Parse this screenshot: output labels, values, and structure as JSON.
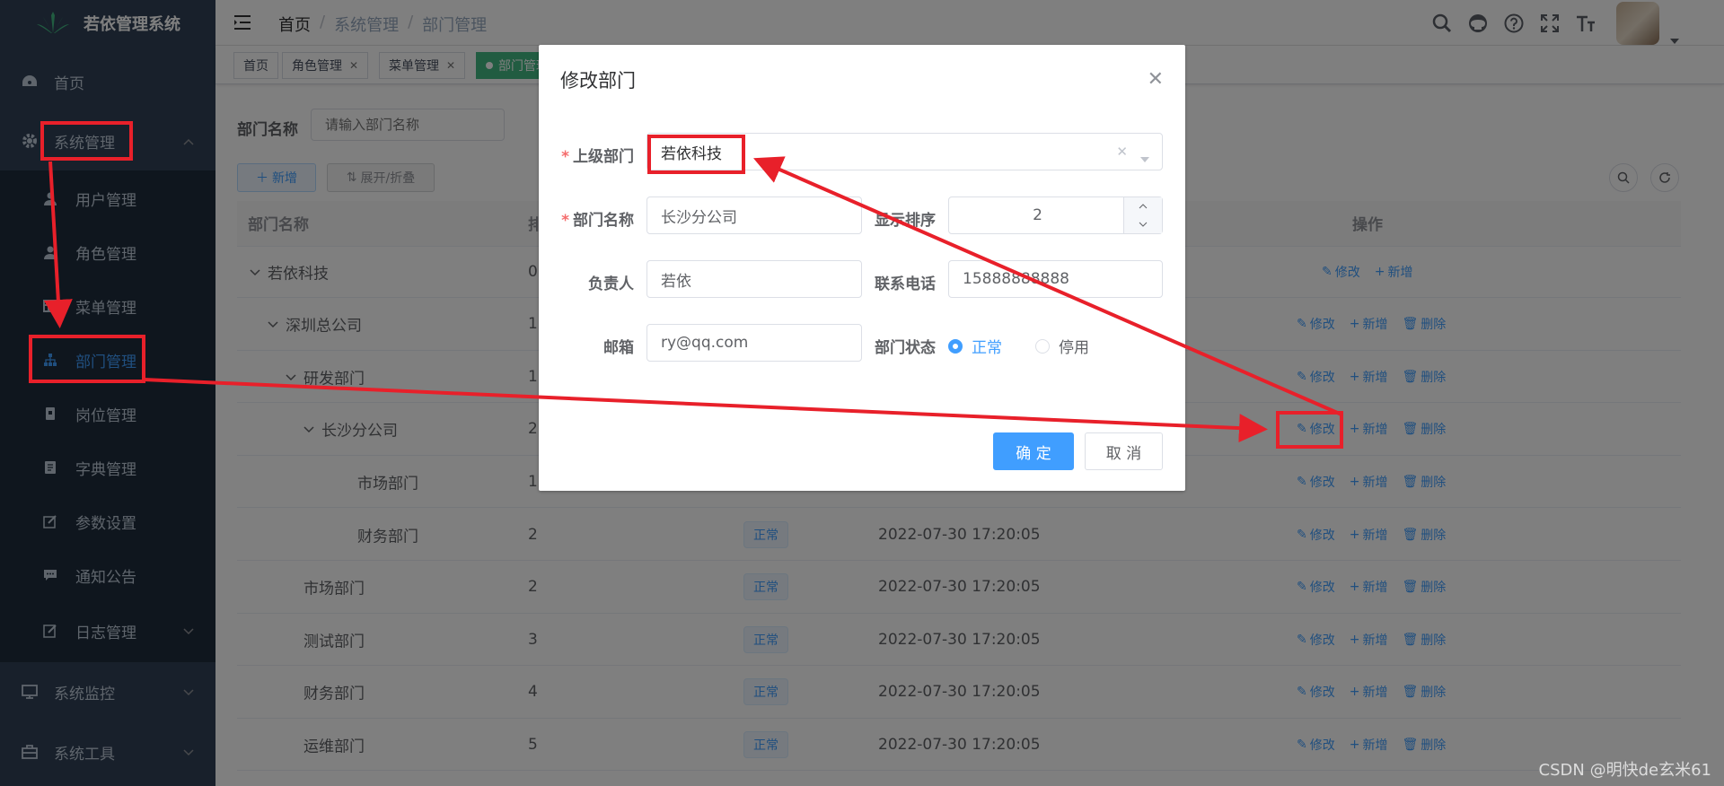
{
  "sidebar": {
    "logo_text": "若依管理系统",
    "home": "首页",
    "system_mgmt": "系统管理",
    "items": [
      "用户管理",
      "角色管理",
      "菜单管理",
      "部门管理",
      "岗位管理",
      "字典管理",
      "参数设置",
      "通知公告",
      "日志管理"
    ],
    "system_monitor": "系统监控",
    "system_tools": "系统工具"
  },
  "navbar": {
    "breadcrumb": [
      "首页",
      "系统管理",
      "部门管理"
    ],
    "sep": "/"
  },
  "tags": [
    "首页",
    "角色管理",
    "菜单管理",
    "部门管理"
  ],
  "search": {
    "label": "部门名称",
    "placeholder": "请输入部门名称"
  },
  "toolbar": {
    "add": "新增",
    "toggle": "展开/折叠"
  },
  "table": {
    "headers": {
      "name": "部门名称",
      "order": "排",
      "ops": "操作"
    },
    "ops": {
      "edit": "修改",
      "add": "新增",
      "delete": "删除"
    },
    "rows": [
      {
        "name": "若依科技",
        "order": "0"
      },
      {
        "name": "深圳总公司",
        "order": "1"
      },
      {
        "name": "研发部门",
        "order": "1"
      },
      {
        "name": "长沙分公司",
        "order": "2"
      },
      {
        "name": "市场部门",
        "order": "1"
      },
      {
        "name": "财务部门",
        "order": "2",
        "status": "正常",
        "time": "2022-07-30 17:20:05"
      },
      {
        "name": "市场部门",
        "order": "2",
        "status": "正常",
        "time": "2022-07-30 17:20:05"
      },
      {
        "name": "测试部门",
        "order": "3",
        "status": "正常",
        "time": "2022-07-30 17:20:05"
      },
      {
        "name": "财务部门",
        "order": "4",
        "status": "正常",
        "time": "2022-07-30 17:20:05"
      },
      {
        "name": "运维部门",
        "order": "5",
        "status": "正常",
        "time": "2022-07-30 17:20:05"
      }
    ]
  },
  "dialog": {
    "title": "修改部门",
    "parent_label": "上级部门",
    "parent_value": "若依科技",
    "name_label": "部门名称",
    "name_value": "长沙分公司",
    "order_label": "显示排序",
    "order_value": "2",
    "leader_label": "负责人",
    "leader_value": "若依",
    "phone_label": "联系电话",
    "phone_value": "15888888888",
    "email_label": "邮箱",
    "email_value": "ry@qq.com",
    "status_label": "部门状态",
    "status_options": [
      "正常",
      "停用"
    ],
    "confirm": "确 定",
    "cancel": "取 消"
  },
  "watermark": "CSDN @明快de玄米61",
  "colors": {
    "primary": "#409eff",
    "sidebar": "#304156",
    "annotation": "#e8202a"
  }
}
